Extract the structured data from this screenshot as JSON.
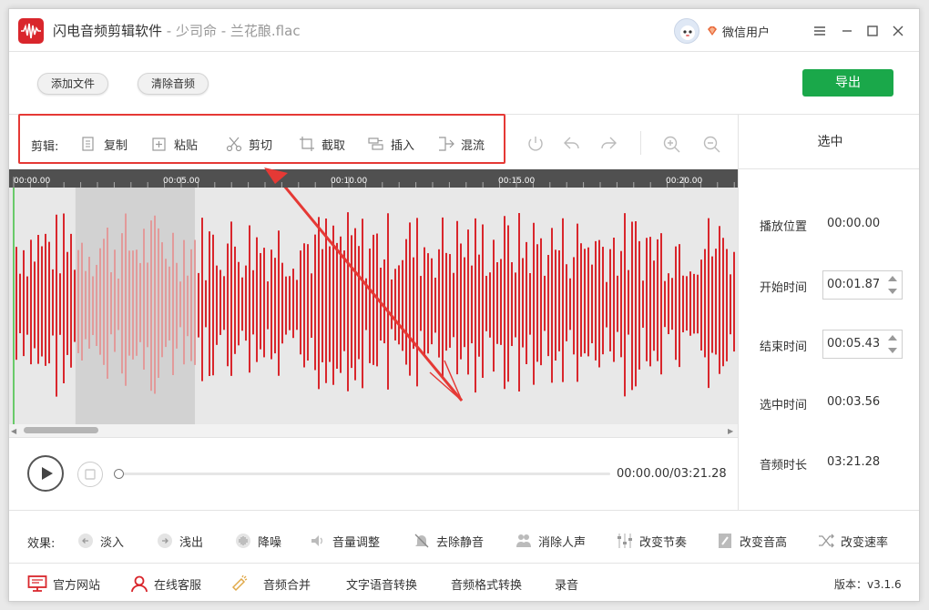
{
  "window": {
    "app_name": "闪电音频剪辑软件",
    "file_info": " - 少司命 - 兰花酿.flac",
    "user_name": "微信用户"
  },
  "toolbar": {
    "add_file_label": "添加文件",
    "clear_audio_label": "清除音频",
    "export_label": "导出"
  },
  "edit": {
    "title": "剪辑:",
    "tools": [
      {
        "label": "复制",
        "icon": "copy-icon"
      },
      {
        "label": "粘贴",
        "icon": "paste-icon"
      },
      {
        "label": "剪切",
        "icon": "cut-icon"
      },
      {
        "label": "截取",
        "icon": "crop-icon"
      },
      {
        "label": "插入",
        "icon": "insert-icon"
      },
      {
        "label": "混流",
        "icon": "mix-icon"
      }
    ],
    "extra_icons": [
      "reset-icon",
      "undo-icon",
      "redo-icon",
      "zoom-in-icon",
      "zoom-out-icon"
    ]
  },
  "timeline": {
    "ticks": [
      "00:00.00",
      "00:05.00",
      "00:10.00",
      "00:15.00",
      "00:20.00"
    ]
  },
  "waveform": {
    "color": "#d9262c",
    "selection_start_fraction": 0.091,
    "selection_end_fraction": 0.255
  },
  "player": {
    "time_display": "00:00.00/03:21.28",
    "progress": 0.0
  },
  "right_panel": {
    "title": "选中",
    "play_position_label": "播放位置",
    "play_position_value": "00:00.00",
    "start_time_label": "开始时间",
    "start_time_value": "00:01.87",
    "end_time_label": "结束时间",
    "end_time_value": "00:05.43",
    "selected_time_label": "选中时间",
    "selected_time_value": "00:03.56",
    "duration_label": "音频时长",
    "duration_value": "03:21.28"
  },
  "effects": {
    "title": "效果:",
    "items": [
      {
        "label": "淡入",
        "icon": "fade-in-icon"
      },
      {
        "label": "浅出",
        "icon": "fade-out-icon"
      },
      {
        "label": "降噪",
        "icon": "denoise-icon"
      },
      {
        "label": "音量调整",
        "icon": "volume-icon"
      },
      {
        "label": "去除静音",
        "icon": "mute-off-icon"
      },
      {
        "label": "消除人声",
        "icon": "vocal-remove-icon"
      },
      {
        "label": "改变节奏",
        "icon": "tempo-icon"
      },
      {
        "label": "改变音高",
        "icon": "pitch-icon"
      },
      {
        "label": "改变速率",
        "icon": "speed-icon"
      }
    ]
  },
  "footer": {
    "official_site": "官方网站",
    "online_service": "在线客服",
    "audio_merge": "音频合并",
    "tts": "文字语音转换",
    "format_convert": "音频格式转换",
    "record": "录音",
    "version": "版本：v3.1.6"
  },
  "colors": {
    "accent_red": "#d9262c",
    "export_green": "#1aa84a",
    "highlight_box": "#e53935"
  }
}
